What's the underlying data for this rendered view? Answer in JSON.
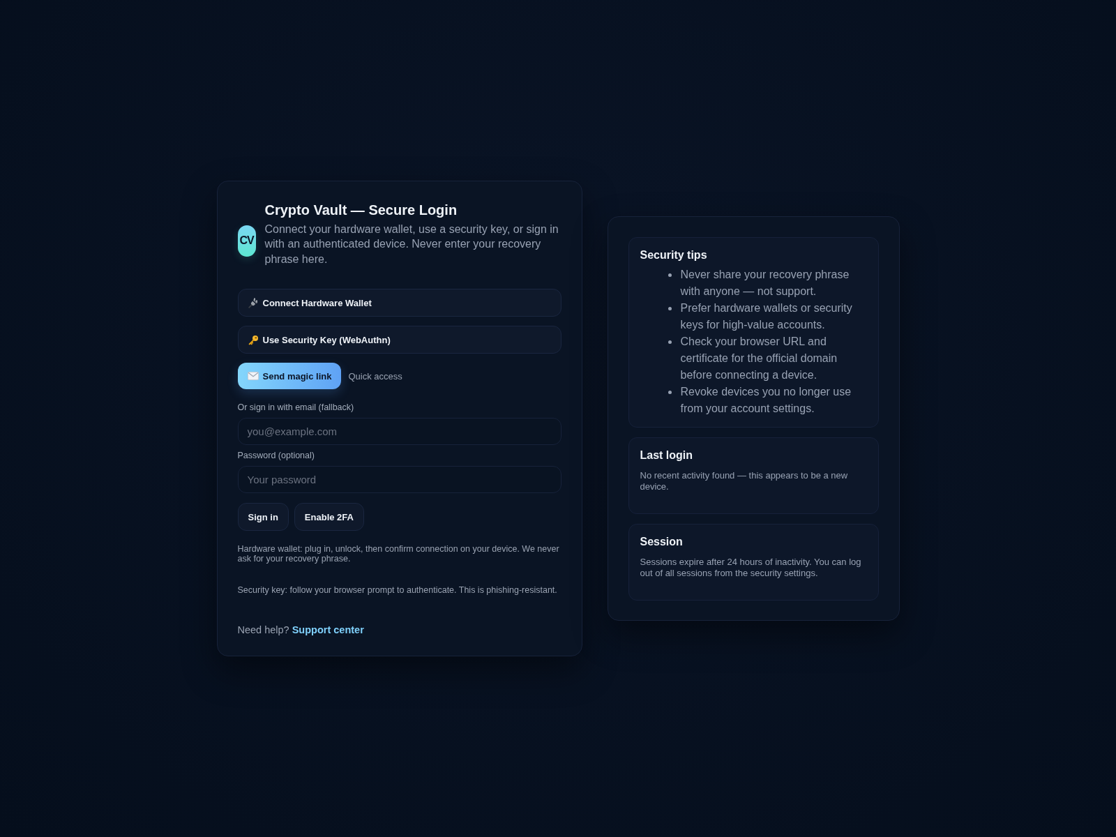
{
  "login_card": {
    "logo": "CV",
    "title": "Crypto Vault — Secure Login",
    "description": "Connect your hardware wallet, use a security key, or sign in with an authenticated device. Never enter your recovery phrase here.",
    "auth_options": [
      {
        "kind": "hardware",
        "label": "Connect Hardware Wallet"
      },
      {
        "kind": "security_key",
        "label": "Use Security Key (WebAuthn)"
      }
    ],
    "magic_link": {
      "label": "Send magic link",
      "hint": "Quick access"
    },
    "email_field": {
      "label": "Or sign in with email (fallback)",
      "placeholder": "you@example.com"
    },
    "password_field": {
      "label": "Password (optional)",
      "placeholder": "Your password"
    },
    "actions": [
      "Sign in",
      "Enable 2FA"
    ],
    "notes": [
      "Hardware wallet: plug in, unlock, then confirm connection on your device. We never ask for your recovery phrase.",
      "Security key: follow your browser prompt to authenticate. This is phishing-resistant."
    ],
    "help": {
      "text": "Need help?",
      "link": "Support center"
    }
  },
  "side_card": {
    "security_tips": {
      "title": "Security tips",
      "items": [
        "Never share your recovery phrase with anyone — not support.",
        "Prefer hardware wallets or security keys for high-value accounts.",
        "Check your browser URL and certificate for the official domain before connecting a device.",
        "Revoke devices you no longer use from your account settings."
      ]
    },
    "last_login": {
      "title": "Last login",
      "text": "No recent activity found — this appears to be a new device."
    },
    "session": {
      "title": "Session",
      "text": "Sessions expire after 24 hours of inactivity. You can log out of all sessions from the security settings."
    }
  }
}
